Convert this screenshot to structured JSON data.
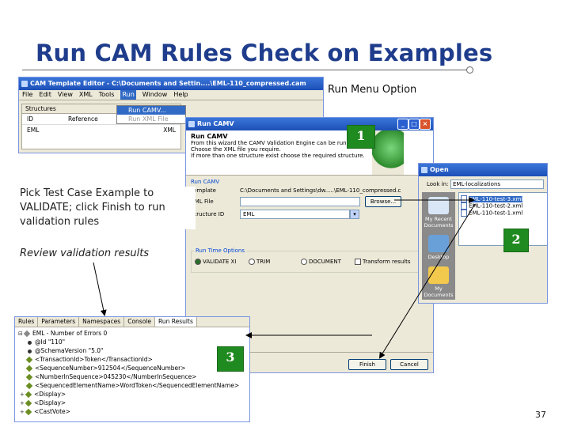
{
  "slide": {
    "title": "Run CAM Rules Check on Examples",
    "page_number": "37",
    "labels": {
      "run_menu": "Run Menu Option",
      "pick_case": "Pick Test Case Example to VALIDATE; click Finish to run validation rules",
      "review": "Review validation results"
    },
    "badges": [
      "1",
      "2",
      "3"
    ],
    "badge_color": "#1f8a1f"
  },
  "cam_editor": {
    "title": "CAM Template Editor - C:\\Documents and Settin....\\EML-110_compressed.cam",
    "menus": [
      "File",
      "Edit",
      "View",
      "XML",
      "Tools",
      "Run",
      "Window",
      "Help"
    ],
    "run_menu_items": [
      "Run CAMV...",
      "Run XML File"
    ],
    "structures_tab": "Structures",
    "columns": [
      "ID",
      "Reference"
    ],
    "row": {
      "id": "EML",
      "ref": "XML"
    }
  },
  "run_camv": {
    "title": "Run CAMV",
    "heading": "Run CAMV",
    "description": [
      "From this wizard the CAMV Validation Engine can be run.",
      "Choose the XML file you require.",
      "If more than one structure exist choose the required structure."
    ],
    "section_label": "Run CAMV",
    "template_label": "Template",
    "template_value": "C:\\Documents and Settings\\dw.....\\EML-110_compressed.c",
    "xml_file_label": "XML File",
    "browse_label": "Browse...",
    "structure_label": "Structure ID",
    "structure_value": "EML",
    "options_label": "Run Time Options",
    "options": [
      "VALIDATE XI",
      "TRIM",
      "DOCUMENT",
      "Transform results"
    ],
    "finish_label": "Finish",
    "cancel_label": "Cancel"
  },
  "open_dialog": {
    "title": "Open",
    "look_in_label": "Look in:",
    "look_in_value": "EML-localizations",
    "files": [
      "EML-110-test-3.xml",
      "EML-110-test-2.xml",
      "EML-110-test-1.xml"
    ],
    "places": [
      "My Recent Documents",
      "Desktop",
      "My Documents"
    ]
  },
  "results": {
    "tabs": [
      "Rules",
      "Parameters",
      "Namespaces",
      "Console",
      "Run Results"
    ],
    "tree": [
      {
        "k": "root",
        "text": "EML - Number of Errors 0"
      },
      {
        "k": "bul",
        "text": "@Id      \"110\""
      },
      {
        "k": "bul",
        "text": "@SchemaVersion      \"5.0\""
      },
      {
        "k": "dia",
        "text": "<TransactionId>Token</TransactionId>"
      },
      {
        "k": "dia",
        "text": "<SequenceNumber>912504</SequenceNumber>"
      },
      {
        "k": "dia",
        "text": "<NumberInSequence>045230</NumberInSequence>"
      },
      {
        "k": "dia",
        "text": "<SequencedElementName>WordToken</SequencedElementName>"
      },
      {
        "k": "dia",
        "text": "<Display>"
      },
      {
        "k": "dia",
        "text": "<Display>"
      },
      {
        "k": "dia",
        "text": "<CastVote>"
      }
    ]
  }
}
